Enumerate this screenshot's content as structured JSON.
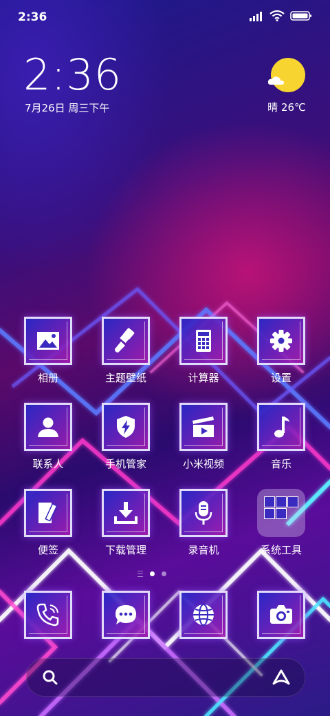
{
  "status_bar": {
    "time": "2:36"
  },
  "clock_widget": {
    "time": "2:36",
    "date": "7月26日 周三下午"
  },
  "weather": {
    "text": "晴 26℃",
    "sun_color": "#f8d430"
  },
  "apps": [
    {
      "label": "相册",
      "icon": "gallery-icon"
    },
    {
      "label": "主题壁纸",
      "icon": "paintbrush-icon"
    },
    {
      "label": "计算器",
      "icon": "calculator-icon"
    },
    {
      "label": "设置",
      "icon": "gear-icon"
    },
    {
      "label": "联系人",
      "icon": "contact-icon"
    },
    {
      "label": "手机管家",
      "icon": "shield-bolt-icon"
    },
    {
      "label": "小米视频",
      "icon": "clapperboard-icon"
    },
    {
      "label": "音乐",
      "icon": "music-note-icon"
    },
    {
      "label": "便签",
      "icon": "note-pen-icon"
    },
    {
      "label": "下载管理",
      "icon": "download-icon"
    },
    {
      "label": "录音机",
      "icon": "microphone-icon"
    },
    {
      "label": "系统工具",
      "icon": "folder-icon"
    }
  ],
  "dock": [
    {
      "name": "phone",
      "icon": "phone-icon"
    },
    {
      "name": "messages",
      "icon": "message-icon"
    },
    {
      "name": "browser",
      "icon": "globe-icon"
    },
    {
      "name": "camera",
      "icon": "camera-icon"
    }
  ],
  "pager": {
    "pages": 2,
    "current": 1
  },
  "search_bar": {
    "left_icon": "search-icon",
    "right_icon": "assistant-icon"
  },
  "colors": {
    "tile_border": "#ebebff",
    "accent": "#3a2ac0"
  }
}
